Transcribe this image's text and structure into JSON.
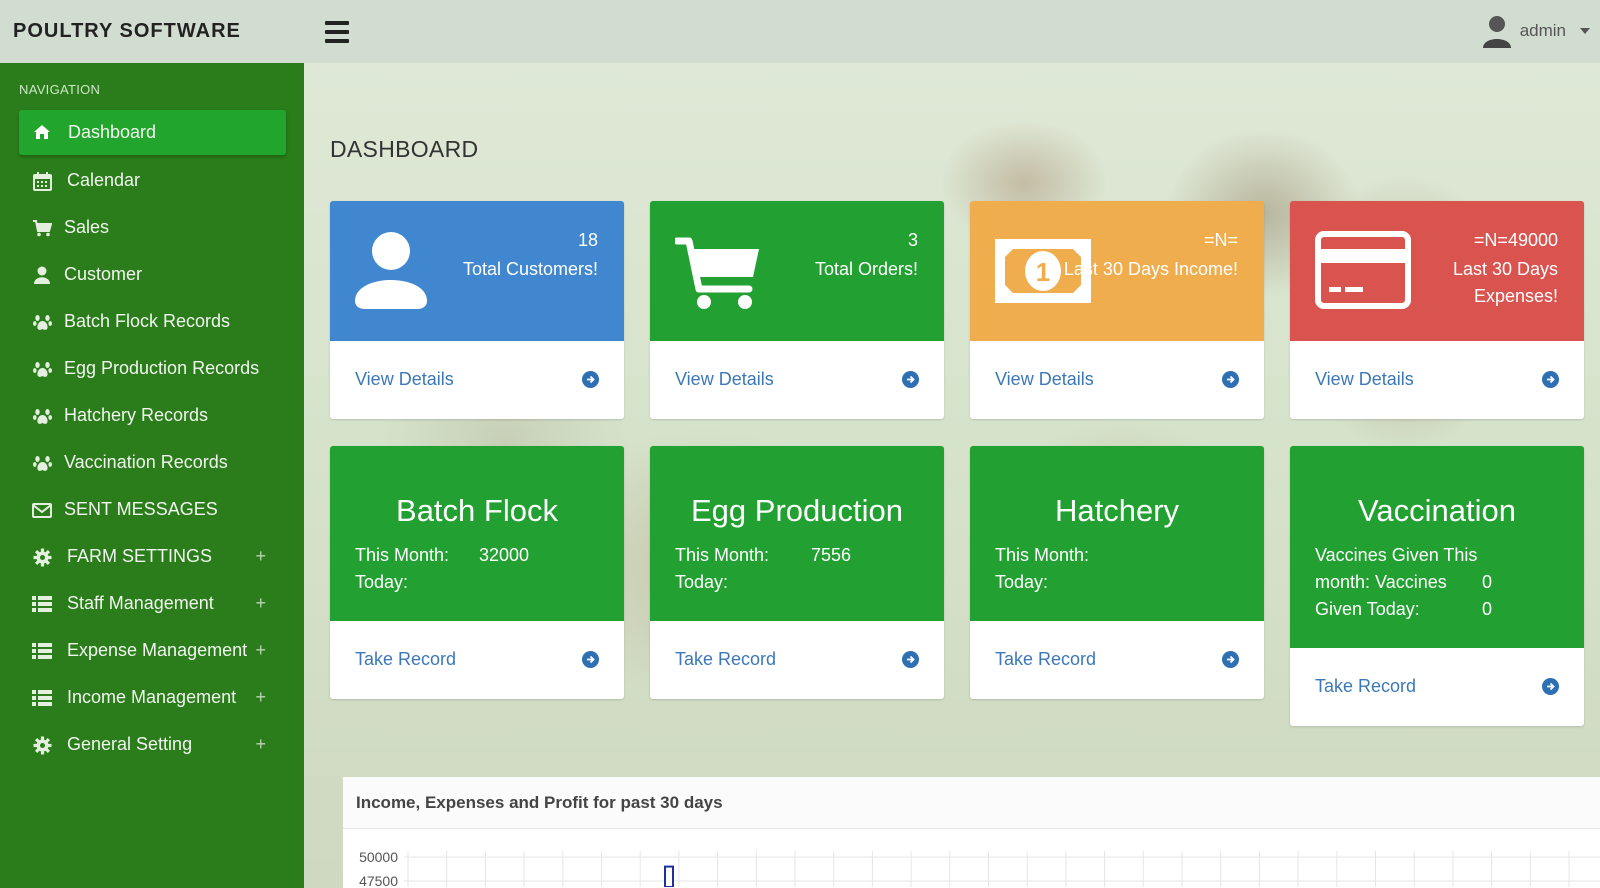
{
  "app": {
    "brand": "POULTRY SOFTWARE",
    "user": "admin"
  },
  "sidebar": {
    "heading": "NAVIGATION",
    "items": [
      {
        "label": "Dashboard",
        "icon": "home-icon",
        "active": true
      },
      {
        "label": "Calendar",
        "icon": "calendar-icon"
      },
      {
        "label": "Sales",
        "icon": "cart-icon"
      },
      {
        "label": "Customer",
        "icon": "user-icon"
      },
      {
        "label": "Batch Flock Records",
        "icon": "paw-icon"
      },
      {
        "label": "Egg Production Records",
        "icon": "paw-icon"
      },
      {
        "label": "Hatchery Records",
        "icon": "paw-icon"
      },
      {
        "label": "Vaccination Records",
        "icon": "paw-icon"
      },
      {
        "label": "SENT MESSAGES",
        "icon": "envelope-icon"
      },
      {
        "label": "FARM SETTINGS",
        "icon": "gear-icon",
        "expand": "+"
      },
      {
        "label": "Staff Management",
        "icon": "list-icon",
        "expand": "+"
      },
      {
        "label": "Expense Management",
        "icon": "list-icon",
        "expand": "+"
      },
      {
        "label": "Income Management",
        "icon": "list-icon",
        "expand": "+"
      },
      {
        "label": "General Setting",
        "icon": "gear-icon",
        "expand": "+"
      }
    ]
  },
  "page": {
    "title": "DASHBOARD"
  },
  "stats": [
    {
      "value": "18",
      "caption": "Total Customers!",
      "link": "View Details",
      "color": "#4187cf",
      "icon": "user-icon"
    },
    {
      "value": "3",
      "caption": "Total Orders!",
      "link": "View Details",
      "color": "#22a031",
      "icon": "cart-icon"
    },
    {
      "value": "=N=",
      "caption": "Last 30 Days Income!",
      "link": "View Details",
      "color": "#efad4d",
      "icon": "money-icon"
    },
    {
      "value": "=N=49000",
      "caption_line1": "Last 30 Days",
      "caption_line2": "Expenses!",
      "link": "View Details",
      "color": "#d9534f",
      "icon": "credit-card-icon"
    }
  ],
  "records": [
    {
      "title": "Batch Flock",
      "month_label": "This Month:",
      "month_value": "32000",
      "today_label": "Today:",
      "today_value": "",
      "link": "Take Record"
    },
    {
      "title": "Egg Production",
      "month_label": "This Month:",
      "month_value": "7556",
      "today_label": "Today:",
      "today_value": "",
      "link": "Take Record"
    },
    {
      "title": "Hatchery",
      "month_label": "This Month:",
      "month_value": "",
      "today_label": "Today:",
      "today_value": "",
      "link": "Take Record"
    },
    {
      "title": "Vaccination",
      "line1": "Vaccines Given This",
      "line2": "month: Vaccines",
      "line2_value": "0",
      "line3": "Given Today:",
      "line3_value": "0",
      "link": "Take Record"
    }
  ],
  "chart": {
    "title": "Income, Expenses and Profit for past 30 days"
  },
  "chart_data": {
    "type": "bar",
    "title": "Income, Expenses and Profit for past 30 days",
    "yticks": [
      "50000",
      "47500"
    ],
    "ylim_visible": [
      47500,
      50000
    ],
    "series": [
      {
        "values": [
          49000
        ],
        "color": "#1f2f9e"
      }
    ]
  }
}
